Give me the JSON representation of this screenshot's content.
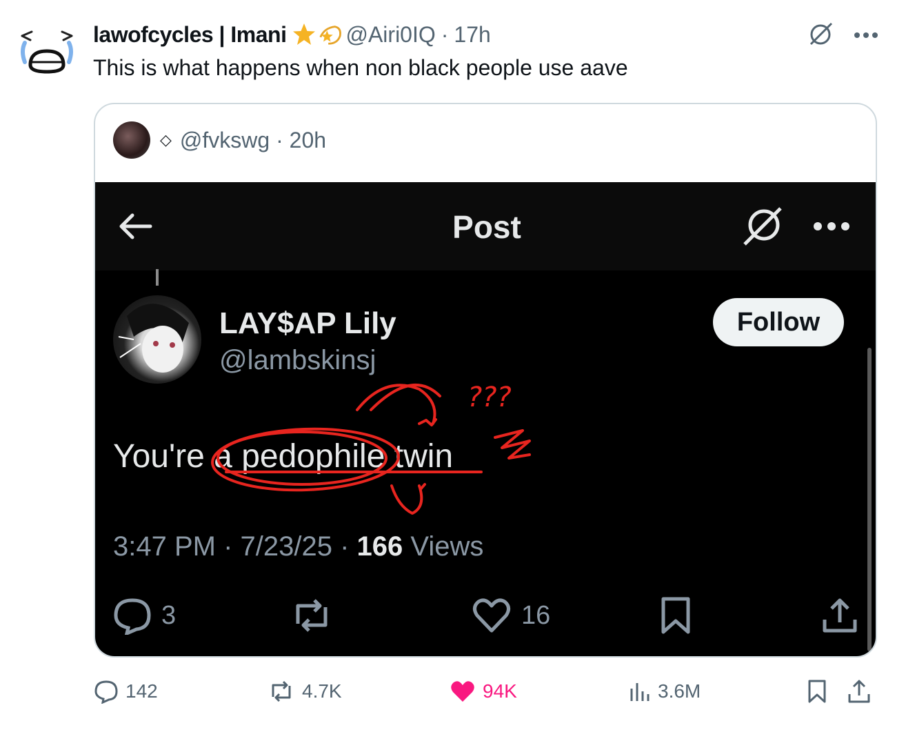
{
  "tweet": {
    "author_name": "lawofcycles | Imani",
    "handle": "@Airi0IQ",
    "time": "17h",
    "text": "This is what happens when non black people use aave",
    "icons": [
      "crying-face-avatar",
      "star-emoji",
      "dizzy-star-emoji",
      "grok-icon",
      "more-icon"
    ]
  },
  "quote": {
    "handle": "@fvkswg",
    "time": "20h",
    "screenshot": {
      "title": "Post",
      "author_name": "LAY$AP Lily",
      "author_handle": "@lambskinsj",
      "follow_label": "Follow",
      "text": "You're a pedophile twin",
      "annotation": "???",
      "meta_time": "3:47 PM",
      "meta_date": "7/23/25",
      "views_count": "166",
      "views_label": "Views",
      "replies": "3",
      "likes": "16",
      "annotation_color": "#e8251f"
    }
  },
  "actions": {
    "replies": "142",
    "reposts": "4.7K",
    "likes": "94K",
    "views": "3.6M",
    "like_color": "#f91880"
  }
}
